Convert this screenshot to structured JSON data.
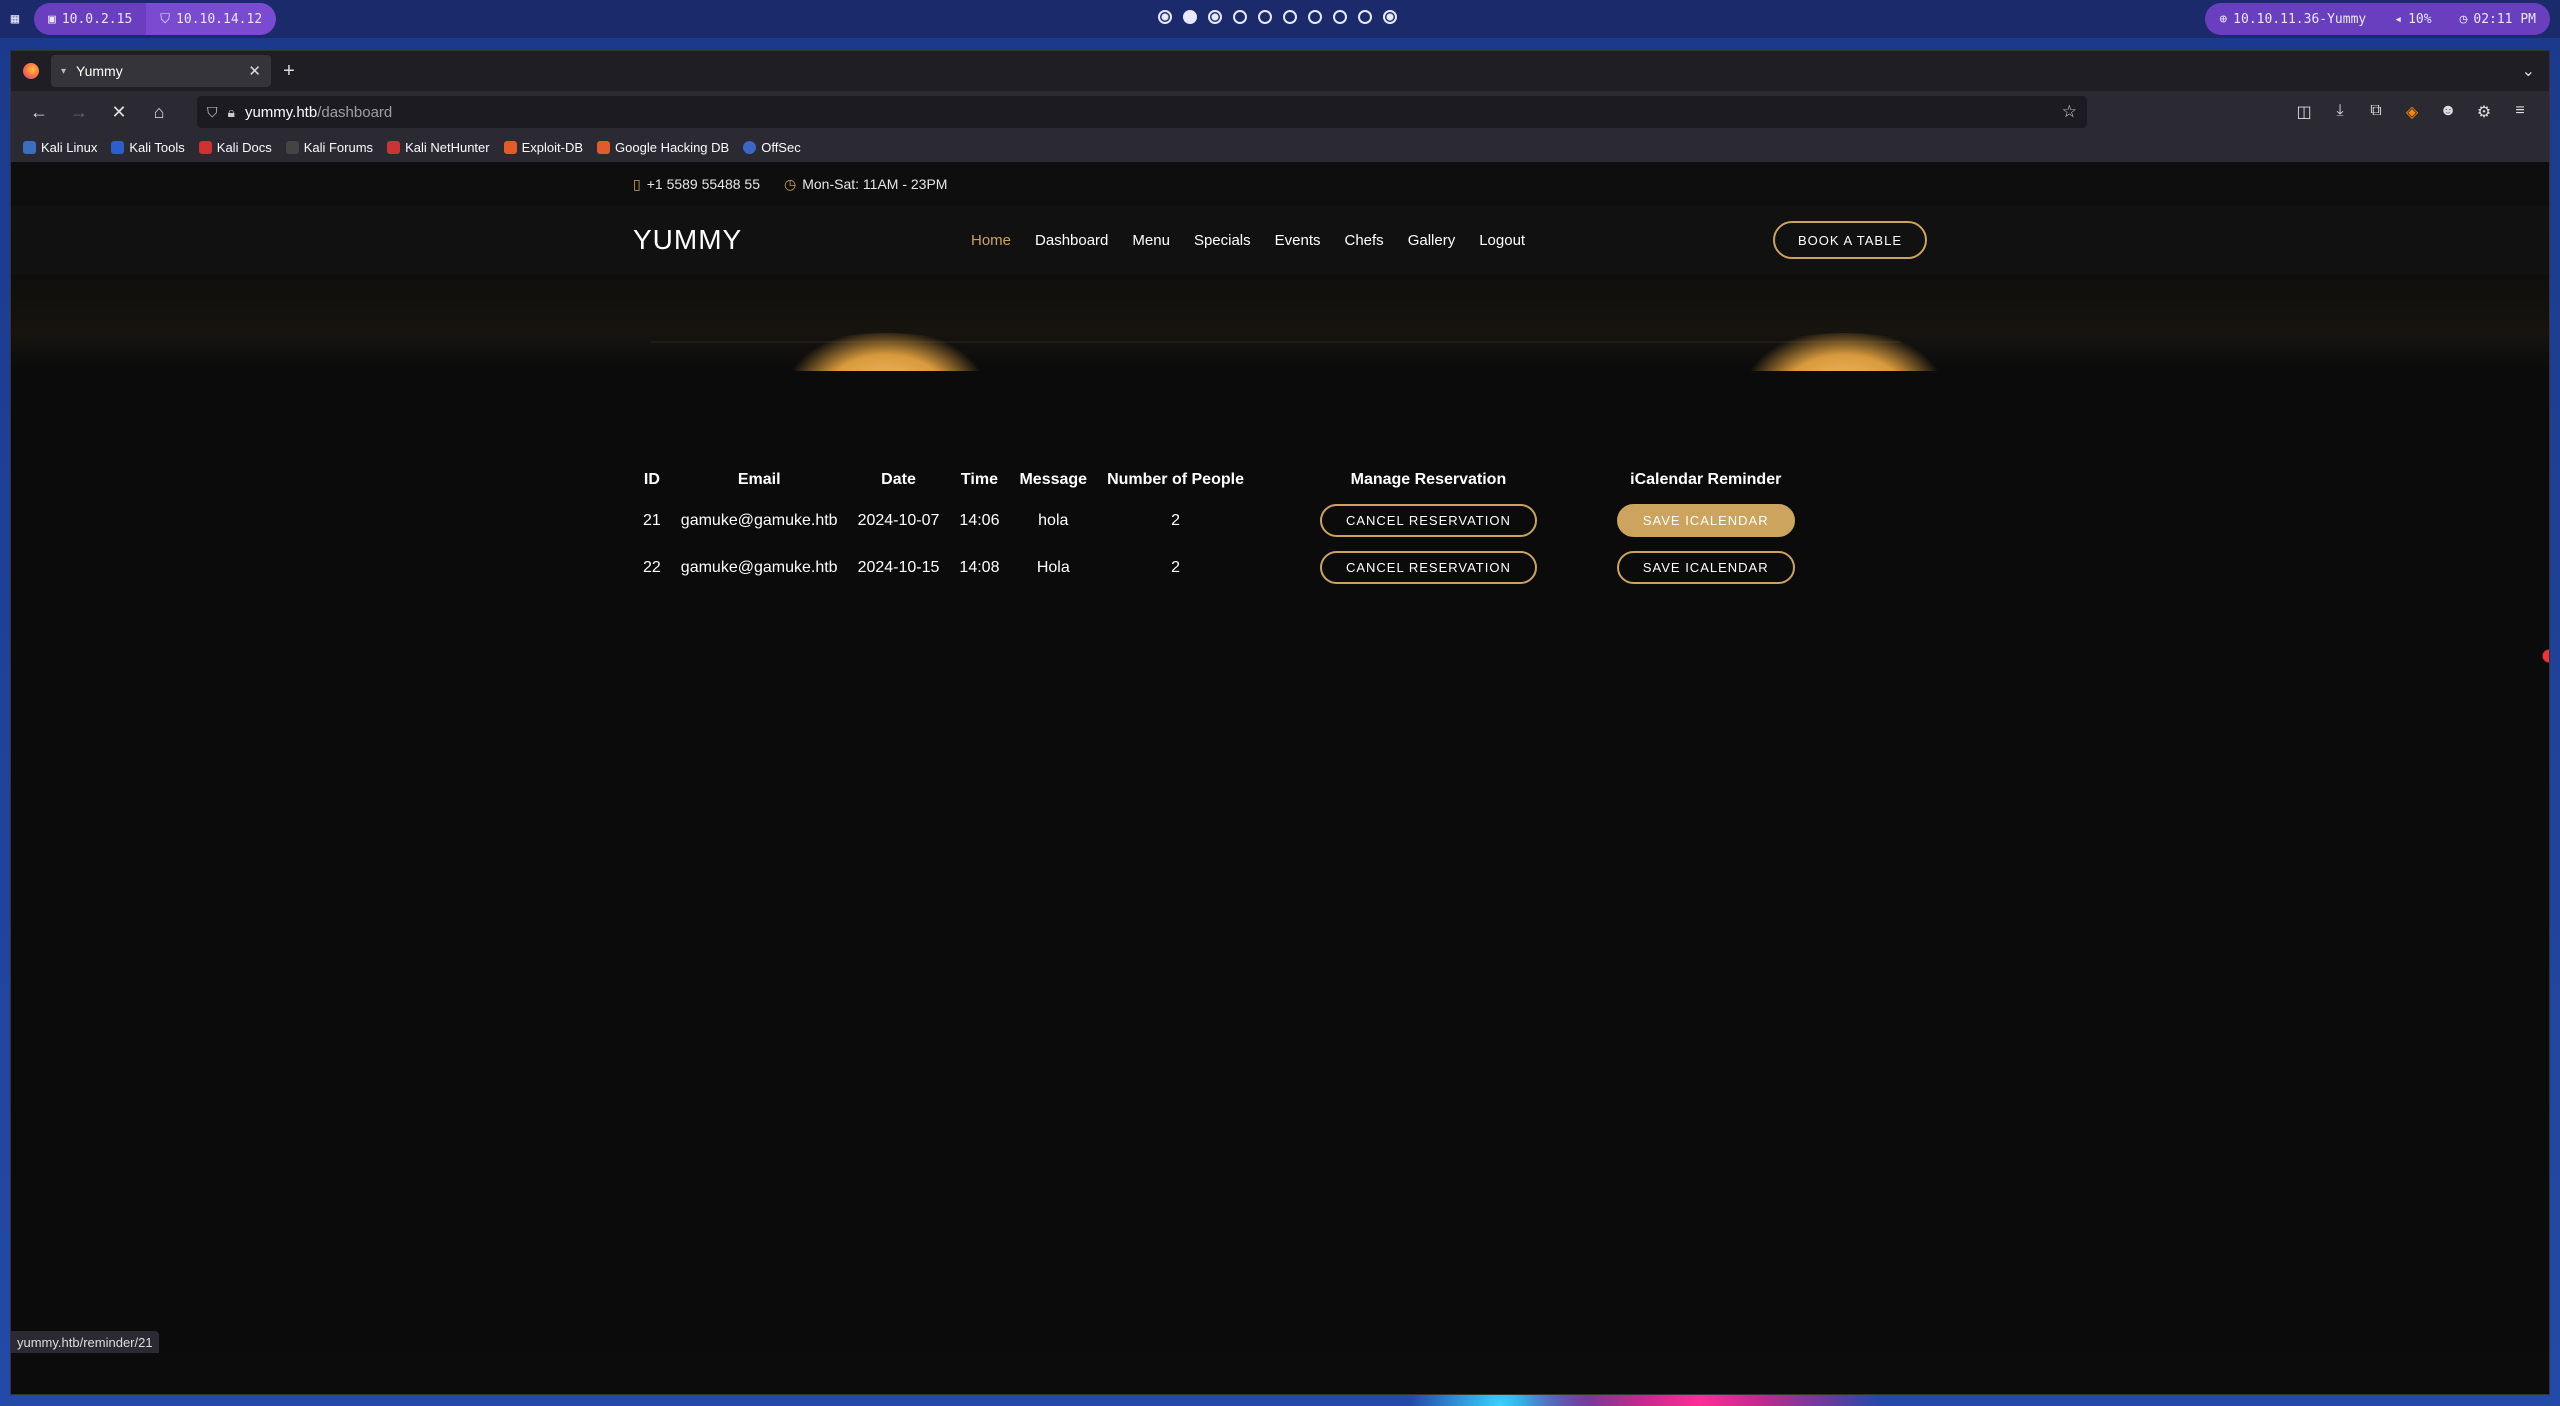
{
  "system_bar": {
    "left_items": [
      "10.0.2.15",
      "10.10.14.12"
    ],
    "workspace_count": 10,
    "active_workspace": 2,
    "target": "10.10.11.36-Yummy",
    "volume": "10%",
    "clock": "02:11 PM"
  },
  "browser": {
    "tab_title": "Yummy",
    "url_host": "yummy.htb",
    "url_path": "/dashboard",
    "bookmarks": [
      "Kali Linux",
      "Kali Tools",
      "Kali Docs",
      "Kali Forums",
      "Kali NetHunter",
      "Exploit-DB",
      "Google Hacking DB",
      "OffSec"
    ],
    "status_url": "yummy.htb/reminder/21"
  },
  "site": {
    "phone": "+1 5589 55488 55",
    "hours": "Mon-Sat: 11AM - 23PM",
    "logo": "YUMMY",
    "nav": [
      "Home",
      "Dashboard",
      "Menu",
      "Specials",
      "Events",
      "Chefs",
      "Gallery",
      "Logout"
    ],
    "active_nav": "Home",
    "book_button": "BOOK A TABLE"
  },
  "reservations": {
    "headers": {
      "id": "ID",
      "email": "Email",
      "date": "Date",
      "time": "Time",
      "message": "Message",
      "people": "Number of People",
      "manage": "Manage Reservation",
      "ical": "iCalendar Reminder"
    },
    "rows": [
      {
        "id": "21",
        "email": "gamuke@gamuke.htb",
        "date": "2024-10-07",
        "time": "14:06",
        "message": "hola",
        "people": "2",
        "cancel": "CANCEL RESERVATION",
        "save": "SAVE ICALENDAR"
      },
      {
        "id": "22",
        "email": "gamuke@gamuke.htb",
        "date": "2024-10-15",
        "time": "14:08",
        "message": "Hola",
        "people": "2",
        "cancel": "CANCEL RESERVATION",
        "save": "SAVE ICALENDAR"
      }
    ]
  },
  "colors": {
    "accent": "#cda45e",
    "page_bg": "#0b0b0b"
  }
}
